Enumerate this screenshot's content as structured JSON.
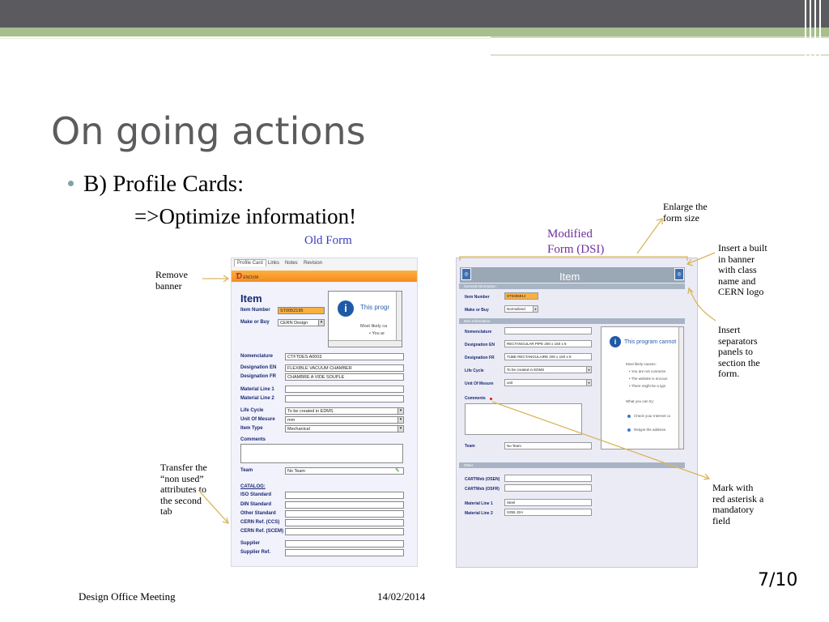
{
  "slide": {
    "title": "On going actions",
    "bullet": "B) Profile Cards:",
    "sub": "=>Optimize information!",
    "page_number": "7/10"
  },
  "labels": {
    "old_form": "Old Form",
    "modified_form_l1": "Modified",
    "modified_form_l2": "Form (DSI)",
    "remove_banner_l1": "Remove",
    "remove_banner_l2": "banner",
    "transfer_l1": "Transfer the",
    "transfer_l2": "“non used”",
    "transfer_l3": "attributes to",
    "transfer_l4": "the second",
    "transfer_l5": "tab",
    "enlarge_l1": "Enlarge the",
    "enlarge_l2": "form size",
    "insert_banner_l1": "Insert a built",
    "insert_banner_l2": "in banner",
    "insert_banner_l3": "with class",
    "insert_banner_l4": "name and",
    "insert_banner_l5": "CERN logo",
    "separators_l1": "Insert",
    "separators_l2": "separators",
    "separators_l3": "panels to",
    "separators_l4": "section the",
    "separators_l5": "form.",
    "mark_l1": "Mark with",
    "mark_l2": "red asterisk a",
    "mark_l3": "mandatory",
    "mark_l4": "field"
  },
  "old_form": {
    "tabs": [
      "Profile Card",
      "Links",
      "Notes",
      "Revision"
    ],
    "logo_text": "ENOVIA",
    "heading": "Item",
    "item_number_label": "Item Number",
    "item_number_value": "ST0052195",
    "make_or_buy_label": "Make or Buy",
    "make_or_buy_value": "CERN Design",
    "popup_title": "This progr",
    "popup_line2": "Most likely ca",
    "popup_line3": "• You ar",
    "nomenclature_label": "Nomenclature",
    "nomenclature_value": "CTFTDES A0003",
    "designation_en_label": "Designation EN",
    "designation_en_value": "FLEXIBLE VACUUM CHAMBER",
    "designation_fr_label": "Designation FR",
    "designation_fr_value": "CHAMBRE A VIDE SOUPLE",
    "material_line1_label": "Material Line 1",
    "material_line2_label": "Material Line 2",
    "life_cycle_label": "Life Cycle",
    "life_cycle_value": "To be created in EDMS",
    "unit_label": "Unit Of Mesure",
    "unit_value": "mm",
    "item_type_label": "Item Type",
    "item_type_value": "Mechanical",
    "comments_label": "Comments",
    "team_label": "Team",
    "team_value": "No Team",
    "catalog_label": "CATALOG:",
    "iso_label": "ISO Standard",
    "din_label": "DIN Standard",
    "other_label": "Other Standard",
    "cern_ccs_label": "CERN Ref. (CCS)",
    "cern_scem_label": "CERN Ref. (SCEM)",
    "supplier_label": "Supplier",
    "supplier_ref_label": "Supplier Ref."
  },
  "new_form": {
    "banner_title": "Item",
    "sep_general": "General Information",
    "sep_item": "Item Information",
    "sep_other": "Other",
    "item_number_label": "Item Number",
    "item_number_value": "ST0455814",
    "make_or_buy_label": "Make or Buy",
    "make_or_buy_value": "Normalized",
    "nomenclature_label": "Nomenclature",
    "designation_en_label": "Designation EN",
    "designation_en_value": "RECTANGULAR PIPE 200 x 150 x 8",
    "designation_fr_label": "Designation FR",
    "designation_fr_value": "TUBE RECTANGULAIRE 200 x 150 x 8",
    "life_cycle_label": "Life Cycle",
    "life_cycle_value": "To be created in EDMS",
    "unit_label": "Unit Of Mesure",
    "unit_value": "unit",
    "comments_label": "Comments",
    "team_label": "Team",
    "team_value": "No Team",
    "popup_title": "This program cannot",
    "popup_line1": "Most likely causes:",
    "popup_line2": "• You are not connecte",
    "popup_line3": "• The website is encoun",
    "popup_line4": "• There might be a typi",
    "popup_line5": "What you can try:",
    "popup_line6": "Check your Internet co",
    "popup_line7": "Retype the address.",
    "cartweb_osen_label": "CARTWeb (OSEN)",
    "cartweb_osfr_label": "CARTWeb (OSFR)",
    "material_line1_label": "Material Line 1",
    "material_line1_value": "Steel",
    "material_line2_label": "Material Line 2",
    "material_line2_value": "S355 J2H"
  },
  "footer": {
    "left": "Design Office Meeting",
    "date": "14/02/2014"
  },
  "colors": {
    "top_bar": "#5b5b5f",
    "green_bar": "#a7bf8e",
    "title": "#5c5c5f",
    "arrow": "#d9b65a",
    "old_form_label": "#3a3ac0",
    "modified_label": "#7030a0"
  }
}
